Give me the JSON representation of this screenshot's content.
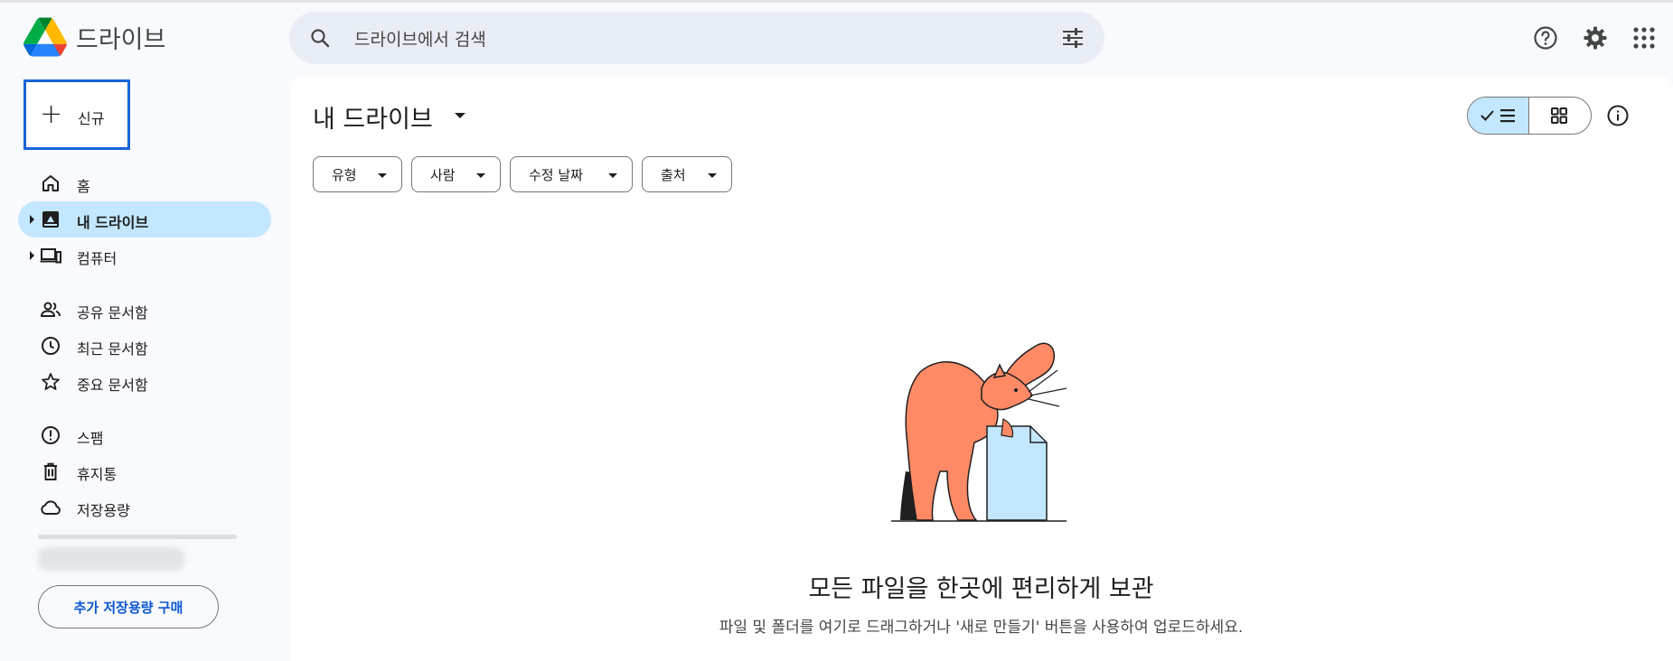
{
  "header": {
    "brand": "드라이브",
    "search_placeholder": "드라이브에서 검색"
  },
  "sidebar": {
    "new_label": "신규",
    "items": [
      {
        "label": "홈"
      },
      {
        "label": "내 드라이브"
      },
      {
        "label": "컴퓨터"
      },
      {
        "label": "공유 문서함"
      },
      {
        "label": "최근 문서함"
      },
      {
        "label": "중요 문서함"
      },
      {
        "label": "스팸"
      },
      {
        "label": "휴지통"
      },
      {
        "label": "저장용량"
      }
    ],
    "buy_storage": "추가 저장용량 구매"
  },
  "main": {
    "title": "내 드라이브",
    "filters": [
      "유형",
      "사람",
      "수정 날짜",
      "출처"
    ],
    "empty_title": "모든 파일을 한곳에 편리하게 보관",
    "empty_subtitle": "파일 및 폴더를 여기로 드래그하거나 '새로 만들기' 버튼을 사용하여 업로드하세요."
  },
  "colors": {
    "accent": "#0b57d0",
    "active_nav": "#c2e7ff",
    "search_bg": "#e9eef6",
    "cat": "#ff8a65"
  }
}
